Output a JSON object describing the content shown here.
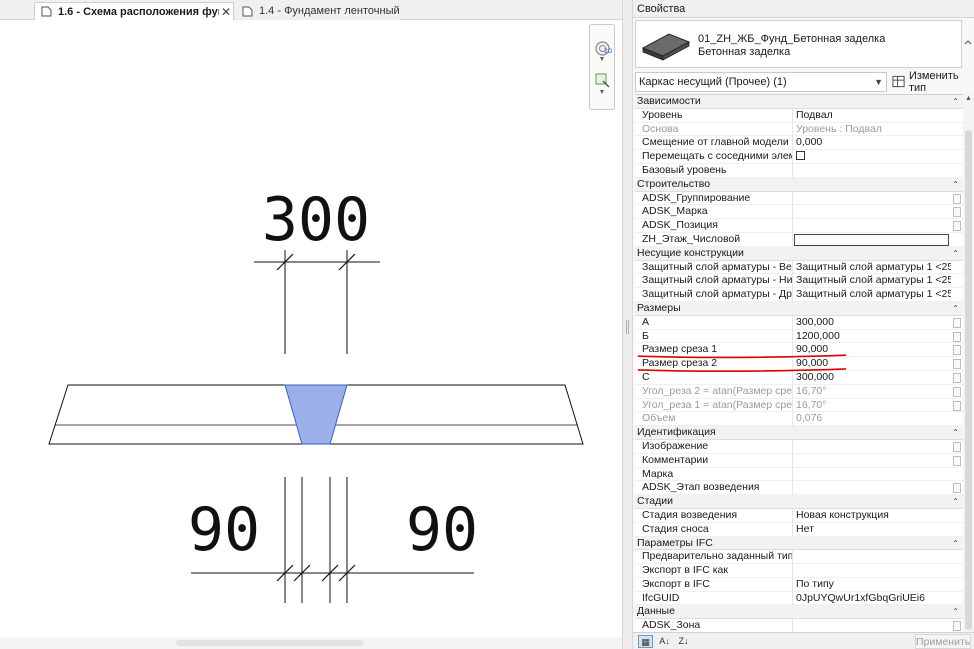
{
  "tabs": [
    {
      "label": "1.6 - Схема расположения фун...",
      "active": true,
      "close": "✕"
    },
    {
      "label": "1.4 - Фундамент ленточный",
      "active": false
    }
  ],
  "drawing": {
    "dim_top": "300",
    "dim_bottom_left": "90",
    "dim_bottom_right": "90",
    "fill_color": "#99b0e8"
  },
  "properties": {
    "title": "Свойства",
    "type_name": "01_ZH_ЖБ_Фунд_Бетонная заделка",
    "type_sub": "Бетонная заделка",
    "filter": "Каркас несущий (Прочее) (1)",
    "edit_type": "Изменить тип",
    "apply": "Применить",
    "sections": [
      {
        "name": "Зависимости",
        "rows": [
          {
            "name": "Уровень",
            "value": "Подвал"
          },
          {
            "name": "Основа",
            "value": "Уровень : Подвал",
            "greyed": true
          },
          {
            "name": "Смещение от главной модели",
            "value": "0,000"
          },
          {
            "name": "Перемещать с соседними элем...",
            "value": "",
            "checkbox": true
          },
          {
            "name": "Базовый уровень",
            "value": ""
          }
        ]
      },
      {
        "name": "Строительство",
        "rows": [
          {
            "name": "ADSK_Группирование",
            "value": "",
            "button": true
          },
          {
            "name": "ADSK_Марка",
            "value": "",
            "button": true
          },
          {
            "name": "ADSK_Позиция",
            "value": "",
            "button": true
          },
          {
            "name": "ZH_Этаж_Числовой",
            "value": "",
            "textbox": true
          }
        ]
      },
      {
        "name": "Несущие конструкции",
        "rows": [
          {
            "name": "Защитный слой арматуры - Ве...",
            "value": "Защитный слой арматуры 1 <25..."
          },
          {
            "name": "Защитный слой арматуры - Ни...",
            "value": "Защитный слой арматуры 1 <25..."
          },
          {
            "name": "Защитный слой арматуры - Др...",
            "value": "Защитный слой арматуры 1 <25..."
          }
        ]
      },
      {
        "name": "Размеры",
        "rows": [
          {
            "name": "А",
            "value": "300,000",
            "button": true
          },
          {
            "name": "Б",
            "value": "1200,000",
            "button": true
          },
          {
            "name": "Размер среза 1",
            "value": "90,000",
            "button": true
          },
          {
            "name": "Размер среза 2",
            "value": "90,000",
            "button": true
          },
          {
            "name": "С",
            "value": "300,000",
            "button": true
          },
          {
            "name": "Угол_реза 2 = atan(Размер срез...",
            "value": "16,70°",
            "greyed": true,
            "button": true
          },
          {
            "name": "Угол_реза 1 = atan(Размер срез...",
            "value": "16,70°",
            "greyed": true,
            "button": true
          },
          {
            "name": "Объем",
            "value": "0,076",
            "greyed": true
          }
        ]
      },
      {
        "name": "Идентификация",
        "rows": [
          {
            "name": "Изображение",
            "value": "",
            "button": true
          },
          {
            "name": "Комментарии",
            "value": "",
            "button": true
          },
          {
            "name": "Марка",
            "value": ""
          },
          {
            "name": "ADSK_Этап возведения",
            "value": "",
            "button": true
          }
        ]
      },
      {
        "name": "Стадии",
        "rows": [
          {
            "name": "Стадия возведения",
            "value": "Новая конструкция"
          },
          {
            "name": "Стадия сноса",
            "value": "Нет"
          }
        ]
      },
      {
        "name": "Параметры IFC",
        "rows": [
          {
            "name": "Предварительно заданный тип I...",
            "value": ""
          },
          {
            "name": "Экспорт в IFC как",
            "value": ""
          },
          {
            "name": "Экспорт в IFC",
            "value": "По типу"
          },
          {
            "name": "IfcGUID",
            "value": "0JpUYQwUr1xfGbqGriUEi6"
          }
        ]
      },
      {
        "name": "Данные",
        "rows": [
          {
            "name": "ADSK_Зона",
            "value": "",
            "button": true
          }
        ]
      }
    ]
  }
}
